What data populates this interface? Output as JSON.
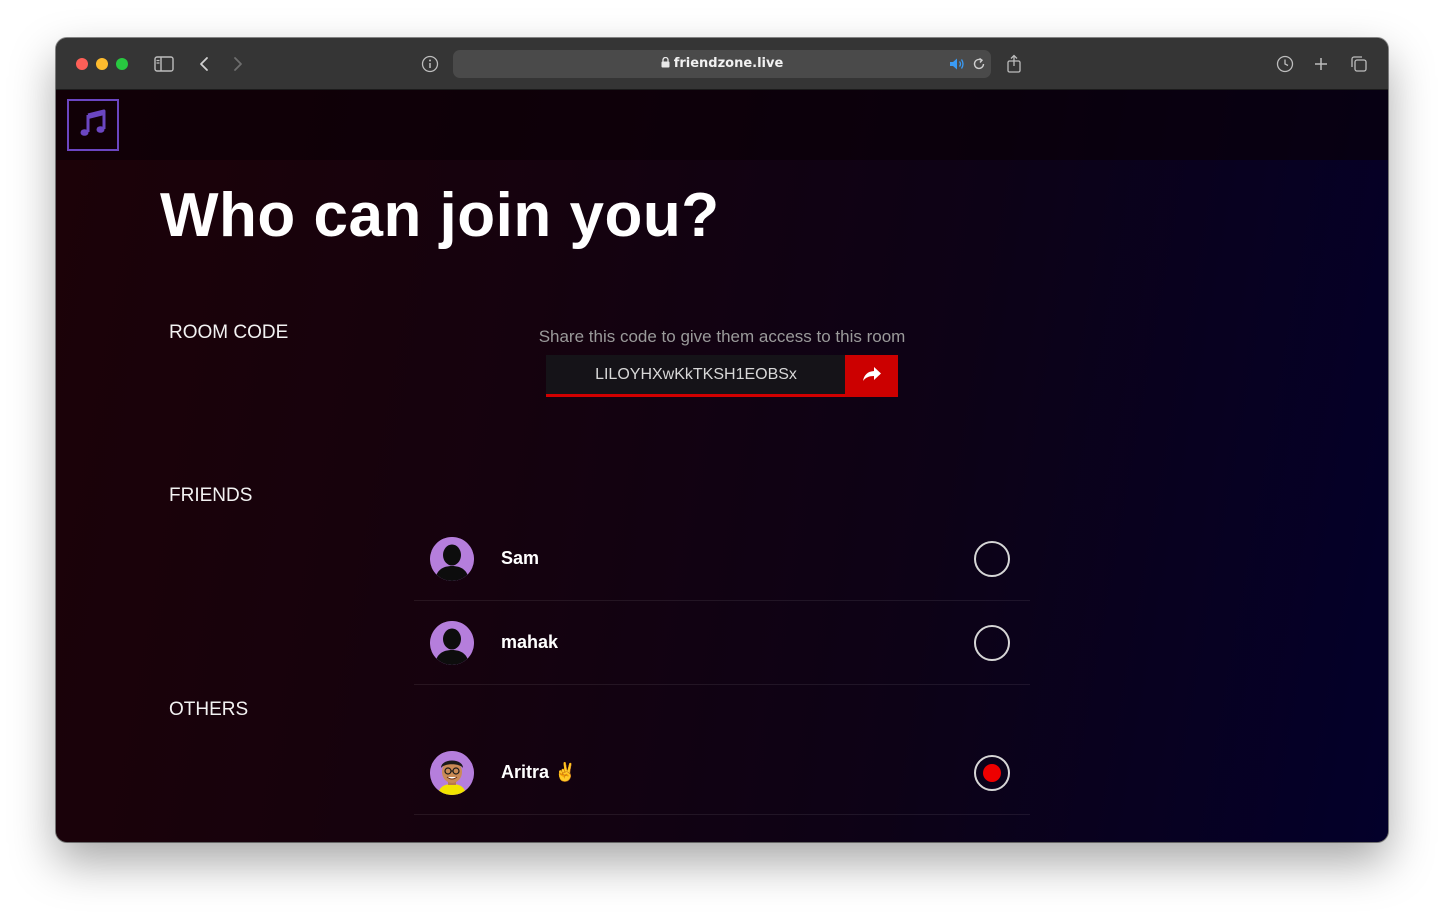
{
  "browser": {
    "url": "friendzone.live"
  },
  "page": {
    "heading": "Who can join you?",
    "room_code_label": "ROOM CODE",
    "room_code_hint": "Share this code to give them access to this room",
    "room_code": "LILOYHXwKkTKSH1EOBSx",
    "friends_label": "FRIENDS",
    "others_label": "OTHERS"
  },
  "friends": [
    {
      "name": "Sam",
      "selected": false
    },
    {
      "name": "mahak",
      "selected": false
    }
  ],
  "others": [
    {
      "name": "Aritra ✌",
      "selected": true
    }
  ],
  "colors": {
    "accent": "#cc0000",
    "logo_border": "#6b46c1",
    "avatar_bg": "#b57edc"
  }
}
